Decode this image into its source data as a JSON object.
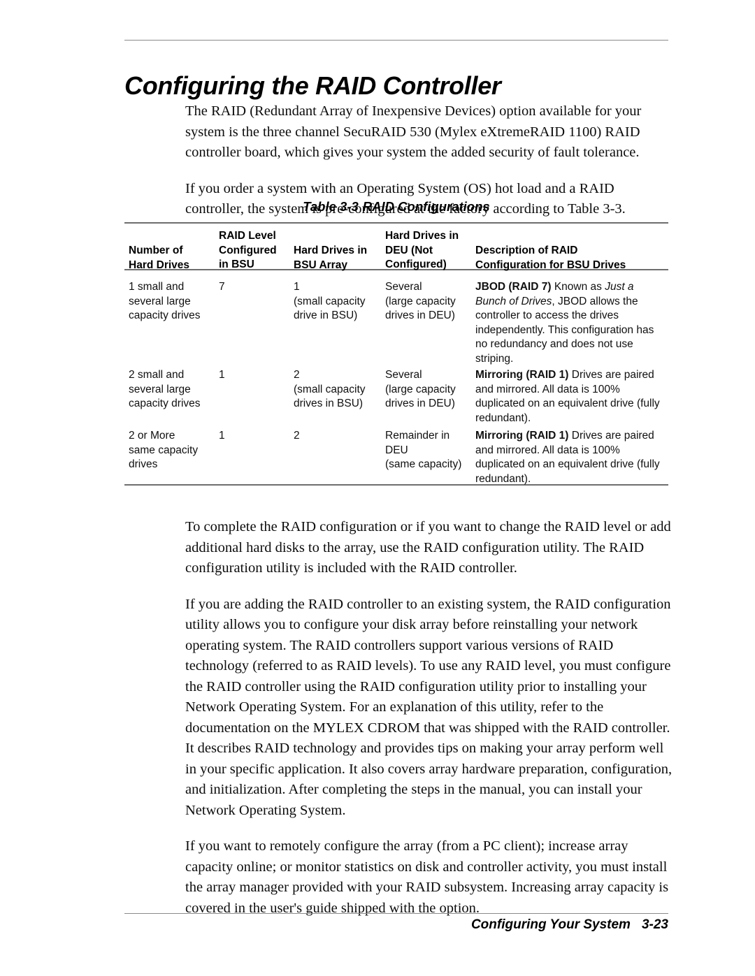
{
  "page": {
    "title": "Configuring the RAID Controller"
  },
  "intro": {
    "paragraphs": [
      "The RAID (Redundant Array of Inexpensive Devices) option available for your system is the three channel SecuRAID 530 (Mylex eXtremeRAID 1100) RAID controller board, which gives your system the added security of fault tolerance.",
      "If you order a system with an Operating System (OS) hot load and a RAID controller, the system is pre-configured at the factory according to Table 3-3."
    ]
  },
  "table": {
    "caption_number": "Table 3-3",
    "caption_title": "RAID Configurations",
    "headers": [
      "Number of\nHard Drives",
      "RAID Level\nConfigured\nin BSU",
      "Hard Drives in\nBSU Array",
      "Hard Drives in\nDEU (Not\nConfigured)",
      "Description of RAID\nConfiguration for BSU Drives"
    ],
    "rows": [
      {
        "number_of_hard_drives": "1 small and\nseveral large\ncapacity drives",
        "raid_level_in_bsu": "7",
        "hard_drives_in_bsu_array": "1\n(small capacity\ndrive in BSU)",
        "hard_drives_in_deu": "Several\n(large capacity\ndrives in DEU)",
        "description_lead": "JBOD (RAID 7)",
        "description_mid": " Known as ",
        "description_italic": "Just a Bunch of Drives",
        "description_tail": ", JBOD allows the controller to access the drives independently. This configuration has no redundancy and does not use striping."
      },
      {
        "number_of_hard_drives": "2 small and\nseveral large\ncapacity drives",
        "raid_level_in_bsu": "1",
        "hard_drives_in_bsu_array": "2\n(small capacity\ndrives in BSU)",
        "hard_drives_in_deu": "Several\n(large capacity\ndrives in DEU)",
        "description_lead": "Mirroring (RAID 1)",
        "description_mid": " Drives are paired and mirrored. All data is 100% duplicated on an equivalent drive (fully redundant).",
        "description_italic": "",
        "description_tail": ""
      },
      {
        "number_of_hard_drives": "2 or More\nsame capacity\ndrives",
        "raid_level_in_bsu": "1",
        "hard_drives_in_bsu_array": "2",
        "hard_drives_in_deu": "Remainder in\nDEU\n(same capacity)",
        "description_lead": "Mirroring (RAID 1)",
        "description_mid": " Drives are paired and mirrored. All data is 100% duplicated on an equivalent drive (fully redundant).",
        "description_italic": "",
        "description_tail": ""
      }
    ]
  },
  "body": {
    "paragraphs": [
      "To complete the RAID configuration or if you want to change the RAID level or add additional hard disks to the array, use the RAID configuration utility. The RAID configuration utility is included with the RAID controller.",
      "If you are adding the RAID controller to an existing system, the RAID configuration utility allows you to configure your disk array before reinstalling your network operating system. The RAID controllers support various versions of RAID technology (referred to as RAID levels). To use any RAID level, you must configure the RAID controller using the RAID configuration utility prior to installing your Network Operating System. For an explanation of this utility, refer to the documentation on the MYLEX CDROM that was shipped with the RAID controller. It describes RAID technology and provides tips on making your array perform well in your specific application. It also covers array hardware preparation, configuration, and initialization. After completing the steps in the manual, you can install your Network Operating System.",
      "If you want to remotely configure the array (from a PC client); increase array capacity online; or monitor statistics on disk and controller activity, you must install the array manager provided with your RAID subsystem. Increasing array capacity is covered in the user's guide shipped with the option."
    ]
  },
  "footer": {
    "section": "Configuring Your System",
    "page_number": "3-23"
  }
}
